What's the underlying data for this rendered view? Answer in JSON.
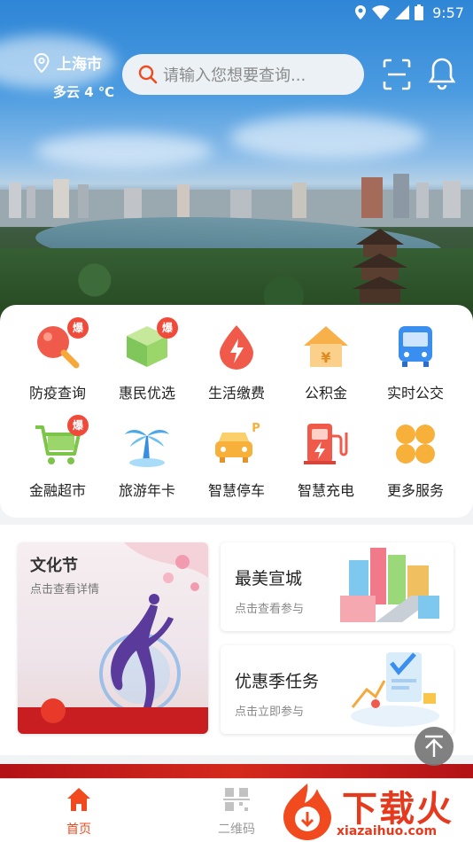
{
  "status_bar": {
    "time": "9:57"
  },
  "header": {
    "city": "上海市",
    "weather": "多云 4 ℃",
    "search_placeholder": "请输入您想要查询..."
  },
  "services": [
    {
      "label": "防疫查询",
      "icon": "magnifier-icon",
      "hot": "爆"
    },
    {
      "label": "惠民优选",
      "icon": "cube-icon",
      "hot": "爆"
    },
    {
      "label": "生活缴费",
      "icon": "lightning-drop-icon",
      "hot": ""
    },
    {
      "label": "公积金",
      "icon": "house-yuan-icon",
      "hot": ""
    },
    {
      "label": "实时公交",
      "icon": "bus-icon",
      "hot": ""
    },
    {
      "label": "金融超市",
      "icon": "shopping-cart-icon",
      "hot": "爆"
    },
    {
      "label": "旅游年卡",
      "icon": "palm-tree-icon",
      "hot": ""
    },
    {
      "label": "智慧停车",
      "icon": "car-parking-icon",
      "hot": ""
    },
    {
      "label": "智慧充电",
      "icon": "charging-station-icon",
      "hot": ""
    },
    {
      "label": "更多服务",
      "icon": "grid-dots-icon",
      "hot": ""
    }
  ],
  "promos": {
    "festival": {
      "title": "文化节",
      "subtitle": "点击查看详情"
    },
    "city": {
      "title": "最美宣城",
      "subtitle": "点击查看参与"
    },
    "tasks": {
      "title": "优惠季任务",
      "subtitle": "点击立即参与"
    }
  },
  "bottom_nav": [
    {
      "label": "首页",
      "icon": "home-icon",
      "active": true
    },
    {
      "label": "二维码",
      "icon": "qr-code-icon",
      "active": false
    }
  ],
  "watermark": {
    "text": "下载火",
    "url": "xiazaihuo.com"
  },
  "colors": {
    "accent": "#f04a1e",
    "hot_badge": "#f04a3a",
    "icon_orange": "#f7a83a",
    "icon_blue": "#3a8ef0",
    "icon_red": "#f05a4a"
  }
}
